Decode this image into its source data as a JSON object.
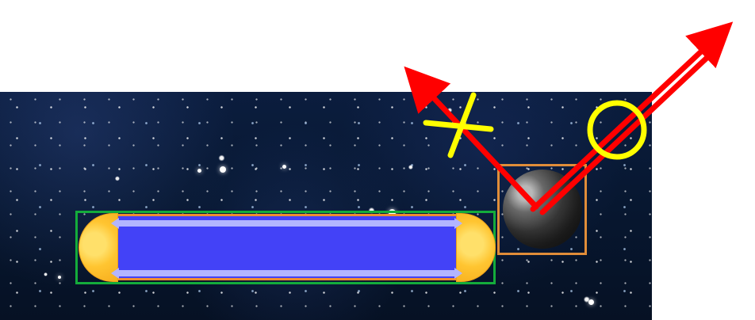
{
  "scene": {
    "background": "starfield-space",
    "colors": {
      "paddle_box": "#14ac3b",
      "ball_box": "#e08d39",
      "trajectory_arrows": "#ff0000",
      "status_markers": "#ffff00",
      "paddle_fill": "#4342f7",
      "paddle_caps": "#ffc531",
      "ball_fill": "#2b2b2b"
    },
    "elements": {
      "paddle": "paddle",
      "ball": "ball",
      "wrong_path": "wrong-path-arrow",
      "correct_path": "correct-path-arrow",
      "wrong_marker": "x-mark-icon",
      "correct_marker": "circle-mark-icon"
    }
  }
}
